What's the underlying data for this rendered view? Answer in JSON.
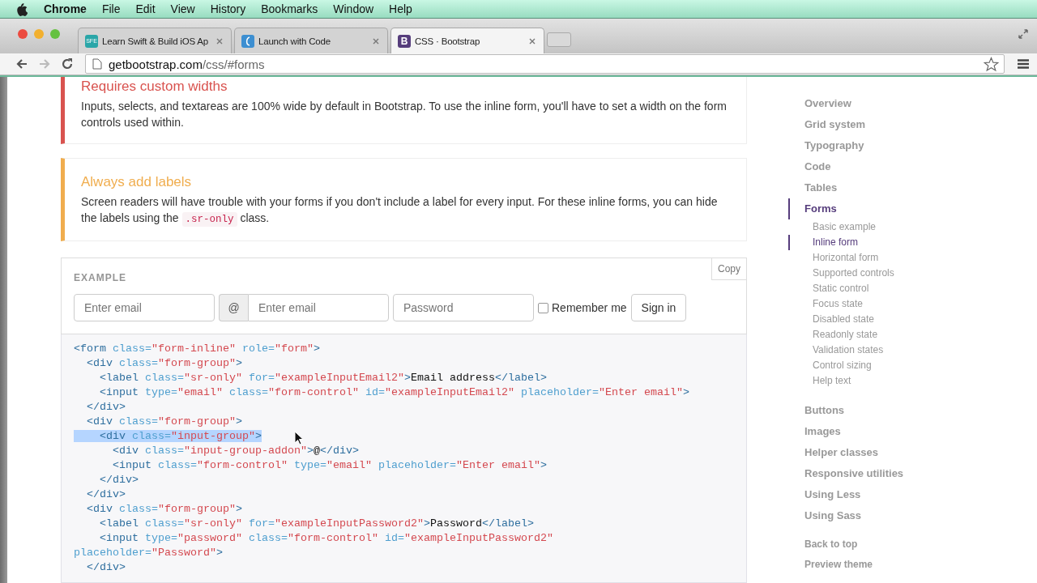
{
  "menu_bar": {
    "app": "Chrome",
    "items": [
      "File",
      "Edit",
      "View",
      "History",
      "Bookmarks",
      "Window",
      "Help"
    ]
  },
  "tabs": [
    {
      "title": "Learn Swift & Build iOS Ap",
      "kind": "sfe",
      "favicon_text": "SFE",
      "selected": false
    },
    {
      "title": "Launch with Code",
      "kind": "launch",
      "selected": false
    },
    {
      "title": "CSS · Bootstrap",
      "kind": "bootstrap",
      "favicon_text": "B",
      "selected": true
    }
  ],
  "address": {
    "host": "getbootstrap.com",
    "path": "/css/#forms"
  },
  "callouts": [
    {
      "kind": "danger",
      "title": "Requires custom widths",
      "text": "Inputs, selects, and textareas are 100% wide by default in Bootstrap. To use the inline form, you'll have to set a width on the form controls used within."
    },
    {
      "kind": "warning",
      "title": "Always add labels",
      "text": "Screen readers will have trouble with your forms if you don't include a label for every input. For these inline forms, you can hide the labels using the ",
      "code": ".sr-only",
      "text_after": " class."
    }
  ],
  "example": {
    "label": "EXAMPLE",
    "copy": "Copy",
    "fields": [
      {
        "kind": "input",
        "placeholder": "Enter email"
      },
      {
        "kind": "addon",
        "addon": "@",
        "placeholder": "Enter email"
      },
      {
        "kind": "input",
        "placeholder": "Password"
      }
    ],
    "checkbox": {
      "label": "Remember me",
      "checked": false
    },
    "submit": "Sign in"
  },
  "code": [
    {
      "highlighted": false,
      "tokens": [
        {
          "kind": "tag",
          "text": "<form"
        },
        {
          "kind": "attr",
          "text": " class="
        },
        {
          "kind": "str",
          "text": "\"form-inline\""
        },
        {
          "kind": "attr",
          "text": " role="
        },
        {
          "kind": "str",
          "text": "\"form\""
        },
        {
          "kind": "tag",
          "text": ">"
        }
      ]
    },
    {
      "highlighted": false,
      "tokens": [
        {
          "kind": "tag",
          "text": "  <div"
        },
        {
          "kind": "attr",
          "text": " class="
        },
        {
          "kind": "str",
          "text": "\"form-group\""
        },
        {
          "kind": "tag",
          "text": ">"
        }
      ]
    },
    {
      "highlighted": false,
      "tokens": [
        {
          "kind": "tag",
          "text": "    <label"
        },
        {
          "kind": "attr",
          "text": " class="
        },
        {
          "kind": "str",
          "text": "\"sr-only\""
        },
        {
          "kind": "attr",
          "text": " for="
        },
        {
          "kind": "str",
          "text": "\"exampleInputEmail2\""
        },
        {
          "kind": "tag",
          "text": ">"
        },
        {
          "kind": "text",
          "text": "Email address"
        },
        {
          "kind": "tag",
          "text": "</label>"
        }
      ]
    },
    {
      "highlighted": false,
      "tokens": [
        {
          "kind": "tag",
          "text": "    <input"
        },
        {
          "kind": "attr",
          "text": " type="
        },
        {
          "kind": "str",
          "text": "\"email\""
        },
        {
          "kind": "attr",
          "text": " class="
        },
        {
          "kind": "str",
          "text": "\"form-control\""
        },
        {
          "kind": "attr",
          "text": " id="
        },
        {
          "kind": "str",
          "text": "\"exampleInputEmail2\""
        },
        {
          "kind": "attr",
          "text": " placeholder="
        },
        {
          "kind": "str",
          "text": "\"Enter email\""
        },
        {
          "kind": "tag",
          "text": ">"
        }
      ]
    },
    {
      "highlighted": false,
      "tokens": [
        {
          "kind": "tag",
          "text": "  </div>"
        }
      ]
    },
    {
      "highlighted": false,
      "tokens": [
        {
          "kind": "tag",
          "text": "  <div"
        },
        {
          "kind": "attr",
          "text": " class="
        },
        {
          "kind": "str",
          "text": "\"form-group\""
        },
        {
          "kind": "tag",
          "text": ">"
        }
      ]
    },
    {
      "highlighted": true,
      "tokens": [
        {
          "kind": "tag",
          "text": "    <div"
        },
        {
          "kind": "attr",
          "text": " class="
        },
        {
          "kind": "str",
          "text": "\"input-group\""
        },
        {
          "kind": "tag",
          "text": ">"
        }
      ]
    },
    {
      "highlighted": false,
      "tokens": [
        {
          "kind": "tag",
          "text": "      <div"
        },
        {
          "kind": "attr",
          "text": " class="
        },
        {
          "kind": "str",
          "text": "\"input-group-addon\""
        },
        {
          "kind": "tag",
          "text": ">"
        },
        {
          "kind": "text",
          "text": "@"
        },
        {
          "kind": "tag",
          "text": "</div>"
        }
      ]
    },
    {
      "highlighted": false,
      "tokens": [
        {
          "kind": "tag",
          "text": "      <input"
        },
        {
          "kind": "attr",
          "text": " class="
        },
        {
          "kind": "str",
          "text": "\"form-control\""
        },
        {
          "kind": "attr",
          "text": " type="
        },
        {
          "kind": "str",
          "text": "\"email\""
        },
        {
          "kind": "attr",
          "text": " placeholder="
        },
        {
          "kind": "str",
          "text": "\"Enter email\""
        },
        {
          "kind": "tag",
          "text": ">"
        }
      ]
    },
    {
      "highlighted": false,
      "tokens": [
        {
          "kind": "tag",
          "text": "    </div>"
        }
      ]
    },
    {
      "highlighted": false,
      "tokens": [
        {
          "kind": "tag",
          "text": "  </div>"
        }
      ]
    },
    {
      "highlighted": false,
      "tokens": [
        {
          "kind": "tag",
          "text": "  <div"
        },
        {
          "kind": "attr",
          "text": " class="
        },
        {
          "kind": "str",
          "text": "\"form-group\""
        },
        {
          "kind": "tag",
          "text": ">"
        }
      ]
    },
    {
      "highlighted": false,
      "tokens": [
        {
          "kind": "tag",
          "text": "    <label"
        },
        {
          "kind": "attr",
          "text": " class="
        },
        {
          "kind": "str",
          "text": "\"sr-only\""
        },
        {
          "kind": "attr",
          "text": " for="
        },
        {
          "kind": "str",
          "text": "\"exampleInputPassword2\""
        },
        {
          "kind": "tag",
          "text": ">"
        },
        {
          "kind": "text",
          "text": "Password"
        },
        {
          "kind": "tag",
          "text": "</label>"
        }
      ]
    },
    {
      "highlighted": false,
      "tokens": [
        {
          "kind": "tag",
          "text": "    <input"
        },
        {
          "kind": "attr",
          "text": " type="
        },
        {
          "kind": "str",
          "text": "\"password\""
        },
        {
          "kind": "attr",
          "text": " class="
        },
        {
          "kind": "str",
          "text": "\"form-control\""
        },
        {
          "kind": "attr",
          "text": " id="
        },
        {
          "kind": "str",
          "text": "\"exampleInputPassword2\""
        }
      ]
    },
    {
      "highlighted": false,
      "tokens": [
        {
          "kind": "attr",
          "text": "placeholder="
        },
        {
          "kind": "str",
          "text": "\"Password\""
        },
        {
          "kind": "tag",
          "text": ">"
        }
      ]
    },
    {
      "highlighted": false,
      "tokens": [
        {
          "kind": "tag",
          "text": "  </div>"
        }
      ]
    }
  ],
  "sidebar": {
    "items": [
      {
        "label": "Overview",
        "selected": false
      },
      {
        "label": "Grid system",
        "selected": false
      },
      {
        "label": "Typography",
        "selected": false
      },
      {
        "label": "Code",
        "selected": false
      },
      {
        "label": "Tables",
        "selected": false
      },
      {
        "label": "Forms",
        "selected": true,
        "children": [
          {
            "label": "Basic example",
            "selected": false
          },
          {
            "label": "Inline form",
            "selected": true
          },
          {
            "label": "Horizontal form",
            "selected": false
          },
          {
            "label": "Supported controls",
            "selected": false
          },
          {
            "label": "Static control",
            "selected": false
          },
          {
            "label": "Focus state",
            "selected": false
          },
          {
            "label": "Disabled state",
            "selected": false
          },
          {
            "label": "Readonly state",
            "selected": false
          },
          {
            "label": "Validation states",
            "selected": false
          },
          {
            "label": "Control sizing",
            "selected": false
          },
          {
            "label": "Help text",
            "selected": false
          }
        ]
      },
      {
        "label": "Buttons",
        "selected": false
      },
      {
        "label": "Images",
        "selected": false
      },
      {
        "label": "Helper classes",
        "selected": false
      },
      {
        "label": "Responsive utilities",
        "selected": false
      },
      {
        "label": "Using Less",
        "selected": false
      },
      {
        "label": "Using Sass",
        "selected": false
      }
    ],
    "footer": [
      "Back to top",
      "Preview theme"
    ]
  }
}
